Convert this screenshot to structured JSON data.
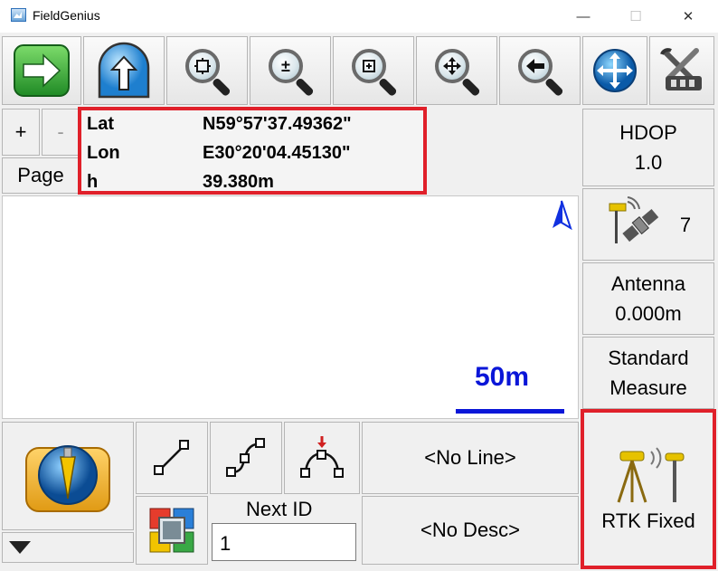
{
  "window": {
    "title": "FieldGenius",
    "minimize": "—",
    "maximize": "☐",
    "close": "✕"
  },
  "toolbar": {
    "zoom_in_out_glyph": "±"
  },
  "left_controls": {
    "plus": "+",
    "minus": "-",
    "page": "Page"
  },
  "readout": {
    "lat_label": "Lat",
    "lat_value": "N59°57'37.49362\"",
    "lon_label": "Lon",
    "lon_value": "E30°20'04.45130\"",
    "h_label": "h",
    "h_value": "39.380m"
  },
  "map": {
    "scale_label": "50m"
  },
  "right_panel": {
    "hdop_label": "HDOP",
    "hdop_value": "1.0",
    "satellites": "7",
    "antenna_label": "Antenna",
    "antenna_value": "0.000m",
    "mode_line1": "Standard",
    "mode_line2": "Measure",
    "rtk_status": "RTK Fixed"
  },
  "bottom": {
    "line_value": "<No Line>",
    "desc_value": "<No Desc>",
    "next_id_label": "Next ID",
    "next_id_value": "1"
  },
  "colors": {
    "highlight": "#e0202a",
    "scale_text": "#0a16d8",
    "north_arrow": "#1030e0"
  }
}
